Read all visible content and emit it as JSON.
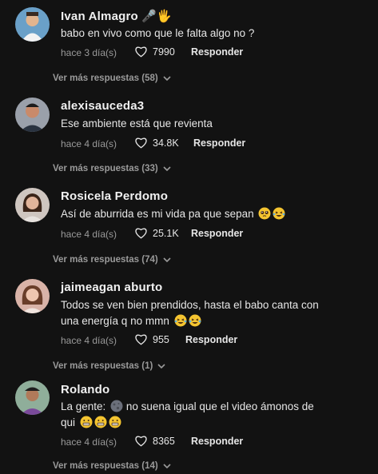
{
  "comments": [
    {
      "username": "Ivan Almagro",
      "username_icons": [
        "microphone-icon",
        "raised-hand-icon"
      ],
      "text": "babo en vivo como que le falta algo no ?",
      "time": "hace 3 día(s)",
      "likes": "7990",
      "reply_label": "Responder",
      "more_replies": "Ver más respuestas (58)"
    },
    {
      "username": "alexisauceda3",
      "text": "Ese ambiente está que revienta",
      "time": "hace 4 día(s)",
      "likes": "34.8K",
      "reply_label": "Responder",
      "more_replies": "Ver más respuestas (33)"
    },
    {
      "username": "Rosicela Perdomo",
      "text": "Así de aburrida es mi vida pa que sepan",
      "text_emojis": [
        "pleading-face-icon",
        "laughing-tears-icon"
      ],
      "time": "hace 4 día(s)",
      "likes": "25.1K",
      "reply_label": "Responder",
      "more_replies": "Ver más respuestas (74)"
    },
    {
      "username": "jaimeagan aburto",
      "text_line1": "Todos se ven bien prendidos, hasta el babo canta con",
      "text_line2": "una energía q no mmn",
      "text_emojis": [
        "laughing-tears-icon",
        "laughing-tears-icon"
      ],
      "time": "hace 4 día(s)",
      "likes": "955",
      "reply_label": "Responder",
      "more_replies": "Ver más respuestas (1)"
    },
    {
      "username": "Rolando",
      "text_part1": "La gente:",
      "text_part2": "no suena igual que el video ámonos de",
      "text_part3": "qui",
      "text_emojis": [
        "new-moon-face-icon",
        "grimacing-face-icon",
        "grimacing-face-icon",
        "grimacing-face-icon"
      ],
      "time": "hace 4 día(s)",
      "likes": "8365",
      "reply_label": "Responder",
      "more_replies": "Ver más respuestas (14)"
    }
  ],
  "colors": {
    "background": "#121212",
    "primary_text": "#e6e6e6",
    "secondary_text": "#9a9a9a"
  }
}
